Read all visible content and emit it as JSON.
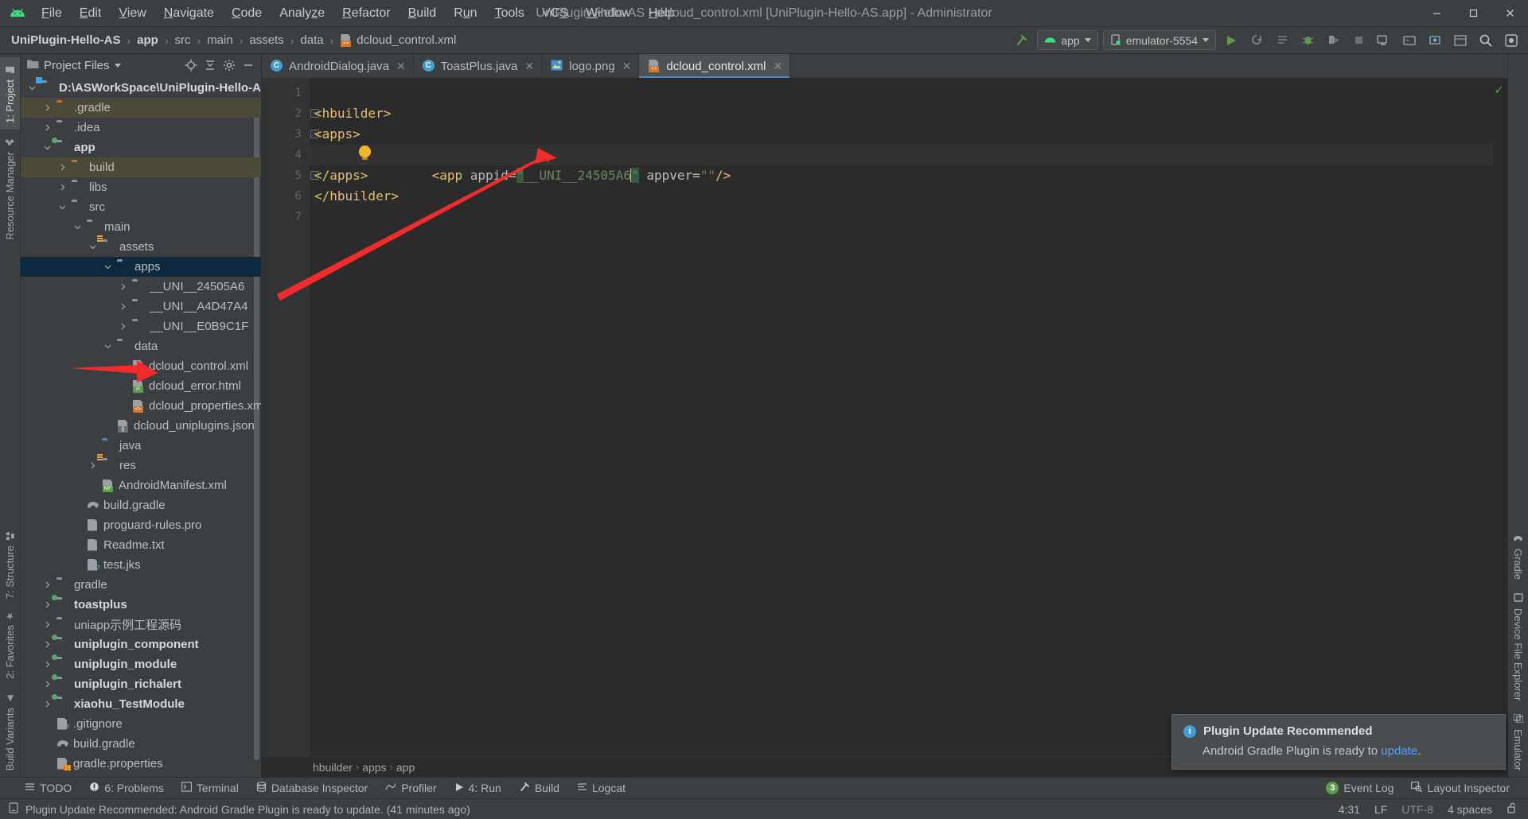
{
  "window": {
    "title": "UniPlugin-Hello-AS - dcloud_control.xml [UniPlugin-Hello-AS.app] - Administrator",
    "minimize": "—",
    "maximize": "▢",
    "close": "✕"
  },
  "menu": [
    {
      "label": "File"
    },
    {
      "label": "Edit"
    },
    {
      "label": "View"
    },
    {
      "label": "Navigate"
    },
    {
      "label": "Code"
    },
    {
      "label": "Analyze"
    },
    {
      "label": "Refactor"
    },
    {
      "label": "Build"
    },
    {
      "label": "Run"
    },
    {
      "label": "Tools"
    },
    {
      "label": "VCS"
    },
    {
      "label": "Window"
    },
    {
      "label": "Help"
    }
  ],
  "breadcrumb": {
    "items": [
      "UniPlugin-Hello-AS",
      "app",
      "src",
      "main",
      "assets",
      "data",
      "dcloud_control.xml"
    ],
    "separator": "›"
  },
  "toolbar": {
    "run_config": "app",
    "device": "emulator-5554",
    "icons": [
      "run-icon",
      "rerun-icon",
      "apply-changes-icon",
      "debug-icon",
      "attach-debugger-icon",
      "profiler-icon",
      "sync-icon",
      "stop-icon",
      "avd-manager-icon",
      "sdk-manager-icon",
      "device-manager-icon",
      "layout-inspector-icon",
      "search-icon",
      "settings-icon"
    ]
  },
  "left_strip": [
    {
      "label": "1: Project",
      "selected": true
    },
    {
      "label": "Resource Manager",
      "selected": false
    },
    {
      "label": "7: Structure",
      "selected": false
    },
    {
      "label": "2: Favorites",
      "selected": false
    },
    {
      "label": "Build Variants",
      "selected": false
    }
  ],
  "right_strip": [
    {
      "label": "Gradle"
    },
    {
      "label": "Device File Explorer"
    },
    {
      "label": "Emulator"
    }
  ],
  "project_panel": {
    "title": "Project Files",
    "tree": [
      {
        "label": "D:\\ASWorkSpace\\UniPlugin-Hello-AS",
        "indent": 0,
        "arrow": "v",
        "icon": "folder-module-root",
        "bold": true,
        "state": "normal"
      },
      {
        "label": ".gradle",
        "indent": 1,
        "arrow": ">",
        "icon": "folder-orange",
        "bold": false,
        "state": "excluded"
      },
      {
        "label": ".idea",
        "indent": 1,
        "arrow": ">",
        "icon": "folder",
        "bold": false,
        "state": "normal"
      },
      {
        "label": "app",
        "indent": 1,
        "arrow": "v",
        "icon": "folder-module",
        "bold": true,
        "state": "normal"
      },
      {
        "label": "build",
        "indent": 2,
        "arrow": ">",
        "icon": "folder-orange",
        "bold": false,
        "state": "excluded"
      },
      {
        "label": "libs",
        "indent": 2,
        "arrow": ">",
        "icon": "folder",
        "bold": false,
        "state": "normal"
      },
      {
        "label": "src",
        "indent": 2,
        "arrow": "v",
        "icon": "folder",
        "bold": false,
        "state": "normal"
      },
      {
        "label": "main",
        "indent": 3,
        "arrow": "v",
        "icon": "folder",
        "bold": false,
        "state": "normal"
      },
      {
        "label": "assets",
        "indent": 4,
        "arrow": "v",
        "icon": "folder-resource",
        "bold": false,
        "state": "normal"
      },
      {
        "label": "apps",
        "indent": 5,
        "arrow": "v",
        "icon": "folder",
        "bold": false,
        "state": "selected"
      },
      {
        "label": "__UNI__24505A6",
        "indent": 6,
        "arrow": ">",
        "icon": "folder",
        "bold": false,
        "state": "normal"
      },
      {
        "label": "__UNI__A4D47A4",
        "indent": 6,
        "arrow": ">",
        "icon": "folder",
        "bold": false,
        "state": "normal"
      },
      {
        "label": "__UNI__E0B9C1F",
        "indent": 6,
        "arrow": ">",
        "icon": "folder",
        "bold": false,
        "state": "normal"
      },
      {
        "label": "data",
        "indent": 5,
        "arrow": "v",
        "icon": "folder",
        "bold": false,
        "state": "normal"
      },
      {
        "label": "dcloud_control.xml",
        "indent": 6,
        "arrow": "",
        "icon": "file-xml",
        "bold": false,
        "state": "normal"
      },
      {
        "label": "dcloud_error.html",
        "indent": 6,
        "arrow": "",
        "icon": "file-html",
        "bold": false,
        "state": "normal"
      },
      {
        "label": "dcloud_properties.xml",
        "indent": 6,
        "arrow": "",
        "icon": "file-xml",
        "bold": false,
        "state": "normal"
      },
      {
        "label": "dcloud_uniplugins.json",
        "indent": 5,
        "arrow": "",
        "icon": "file-json",
        "bold": false,
        "state": "normal"
      },
      {
        "label": "java",
        "indent": 4,
        "arrow": "",
        "icon": "folder-blue",
        "bold": false,
        "state": "normal"
      },
      {
        "label": "res",
        "indent": 4,
        "arrow": ">",
        "icon": "folder-resource",
        "bold": false,
        "state": "normal"
      },
      {
        "label": "AndroidManifest.xml",
        "indent": 4,
        "arrow": "",
        "icon": "file-manifest",
        "bold": false,
        "state": "normal"
      },
      {
        "label": "build.gradle",
        "indent": 3,
        "arrow": "",
        "icon": "file-gradle",
        "bold": false,
        "state": "normal"
      },
      {
        "label": "proguard-rules.pro",
        "indent": 3,
        "arrow": "",
        "icon": "file-text",
        "bold": false,
        "state": "normal"
      },
      {
        "label": "Readme.txt",
        "indent": 3,
        "arrow": "",
        "icon": "file-text",
        "bold": false,
        "state": "normal"
      },
      {
        "label": "test.jks",
        "indent": 3,
        "arrow": "",
        "icon": "file-unknown",
        "bold": false,
        "state": "normal"
      },
      {
        "label": "gradle",
        "indent": 1,
        "arrow": ">",
        "icon": "folder",
        "bold": false,
        "state": "normal"
      },
      {
        "label": "toastplus",
        "indent": 1,
        "arrow": ">",
        "icon": "folder-module",
        "bold": true,
        "state": "normal"
      },
      {
        "label": "uniapp示例工程源码",
        "indent": 1,
        "arrow": ">",
        "icon": "folder",
        "bold": false,
        "state": "normal"
      },
      {
        "label": "uniplugin_component",
        "indent": 1,
        "arrow": ">",
        "icon": "folder-module",
        "bold": true,
        "state": "normal"
      },
      {
        "label": "uniplugin_module",
        "indent": 1,
        "arrow": ">",
        "icon": "folder-module",
        "bold": true,
        "state": "normal"
      },
      {
        "label": "uniplugin_richalert",
        "indent": 1,
        "arrow": ">",
        "icon": "folder-module",
        "bold": true,
        "state": "normal"
      },
      {
        "label": "xiaohu_TestModule",
        "indent": 1,
        "arrow": ">",
        "icon": "folder-module",
        "bold": true,
        "state": "normal"
      },
      {
        "label": ".gitignore",
        "indent": 1,
        "arrow": "",
        "icon": "file-gitignore",
        "bold": false,
        "state": "normal"
      },
      {
        "label": "build.gradle",
        "indent": 1,
        "arrow": "",
        "icon": "file-gradle",
        "bold": false,
        "state": "normal"
      },
      {
        "label": "gradle.properties",
        "indent": 1,
        "arrow": "",
        "icon": "file-properties",
        "bold": false,
        "state": "normal"
      }
    ]
  },
  "editor": {
    "tabs": [
      {
        "label": "AndroidDialog.java",
        "icon": "java-class-icon",
        "active": false,
        "close": "✕"
      },
      {
        "label": "ToastPlus.java",
        "icon": "java-class-icon",
        "active": false,
        "close": "✕"
      },
      {
        "label": "logo.png",
        "icon": "image-icon",
        "active": false,
        "close": "✕"
      },
      {
        "label": "dcloud_control.xml",
        "icon": "xml-file-icon",
        "active": true,
        "close": "✕"
      }
    ],
    "line_numbers": [
      "1",
      "2",
      "3",
      "4",
      "5",
      "6",
      "7"
    ],
    "lines": [
      {
        "n": 1,
        "text": "",
        "fold": ""
      },
      {
        "n": 2,
        "text": "<hbuilder>",
        "fold": "-"
      },
      {
        "n": 3,
        "text": "<apps>",
        "fold": "-"
      },
      {
        "n": 4,
        "text": "  <app appid=\"__UNI__24505A6\" appver=\"\"/>",
        "fold": ""
      },
      {
        "n": 5,
        "text": "</apps>",
        "fold": "-"
      },
      {
        "n": 6,
        "text": "</hbuilder>",
        "fold": ""
      },
      {
        "n": 7,
        "text": "",
        "fold": ""
      }
    ],
    "code": {
      "l2_tag": "<hbuilder>",
      "l3_tag": "<apps>",
      "l4_open": "<app ",
      "l4_attr1": "appid=",
      "l4_quote": "\"",
      "l4_value": "__UNI__24505A6",
      "l4_attr2": " appver=",
      "l4_value2": "\"\"",
      "l4_close": "/>",
      "l5_tag": "</apps>",
      "l6_tag": "</hbuilder>"
    },
    "bottom_breadcrumb": [
      "hbuilder",
      "apps",
      "app"
    ],
    "inspection_status": "✓"
  },
  "notification": {
    "title": "Plugin Update Recommended",
    "body_before": "Android Gradle Plugin is ready to ",
    "link": "update",
    "body_after": "."
  },
  "tool_windows": [
    {
      "label": "TODO",
      "icon": "todo-icon"
    },
    {
      "label": "6: Problems",
      "icon": "problems-icon"
    },
    {
      "label": "Terminal",
      "icon": "terminal-icon"
    },
    {
      "label": "Database Inspector",
      "icon": "database-icon"
    },
    {
      "label": "Profiler",
      "icon": "profiler-icon"
    },
    {
      "label": "4: Run",
      "icon": "run-icon"
    },
    {
      "label": "Build",
      "icon": "build-icon"
    },
    {
      "label": "Logcat",
      "icon": "logcat-icon"
    }
  ],
  "tool_windows_right": [
    {
      "label": "Event Log",
      "icon": "event-log-icon",
      "badge": "3"
    },
    {
      "label": "Layout Inspector",
      "icon": "layout-inspector-icon",
      "badge": ""
    }
  ],
  "status_bar": {
    "message": "Plugin Update Recommended: Android Gradle Plugin is ready to update. (41 minutes ago)",
    "caret": "4:31",
    "line_sep": "LF",
    "encoding": "UTF-8",
    "indent": "4 spaces",
    "lock": "lock-open-icon"
  },
  "colors": {
    "accent_blue": "#4a88c7",
    "selection_blue": "#0d293e",
    "excluded_brown": "#4b4a39",
    "annotation_red": "#f42b2b",
    "editor_bg": "#2b2b2b",
    "panel_bg": "#3c3f41",
    "string_green": "#6a8759",
    "tag_yellow": "#e8bf6a",
    "link_blue": "#589df6"
  }
}
